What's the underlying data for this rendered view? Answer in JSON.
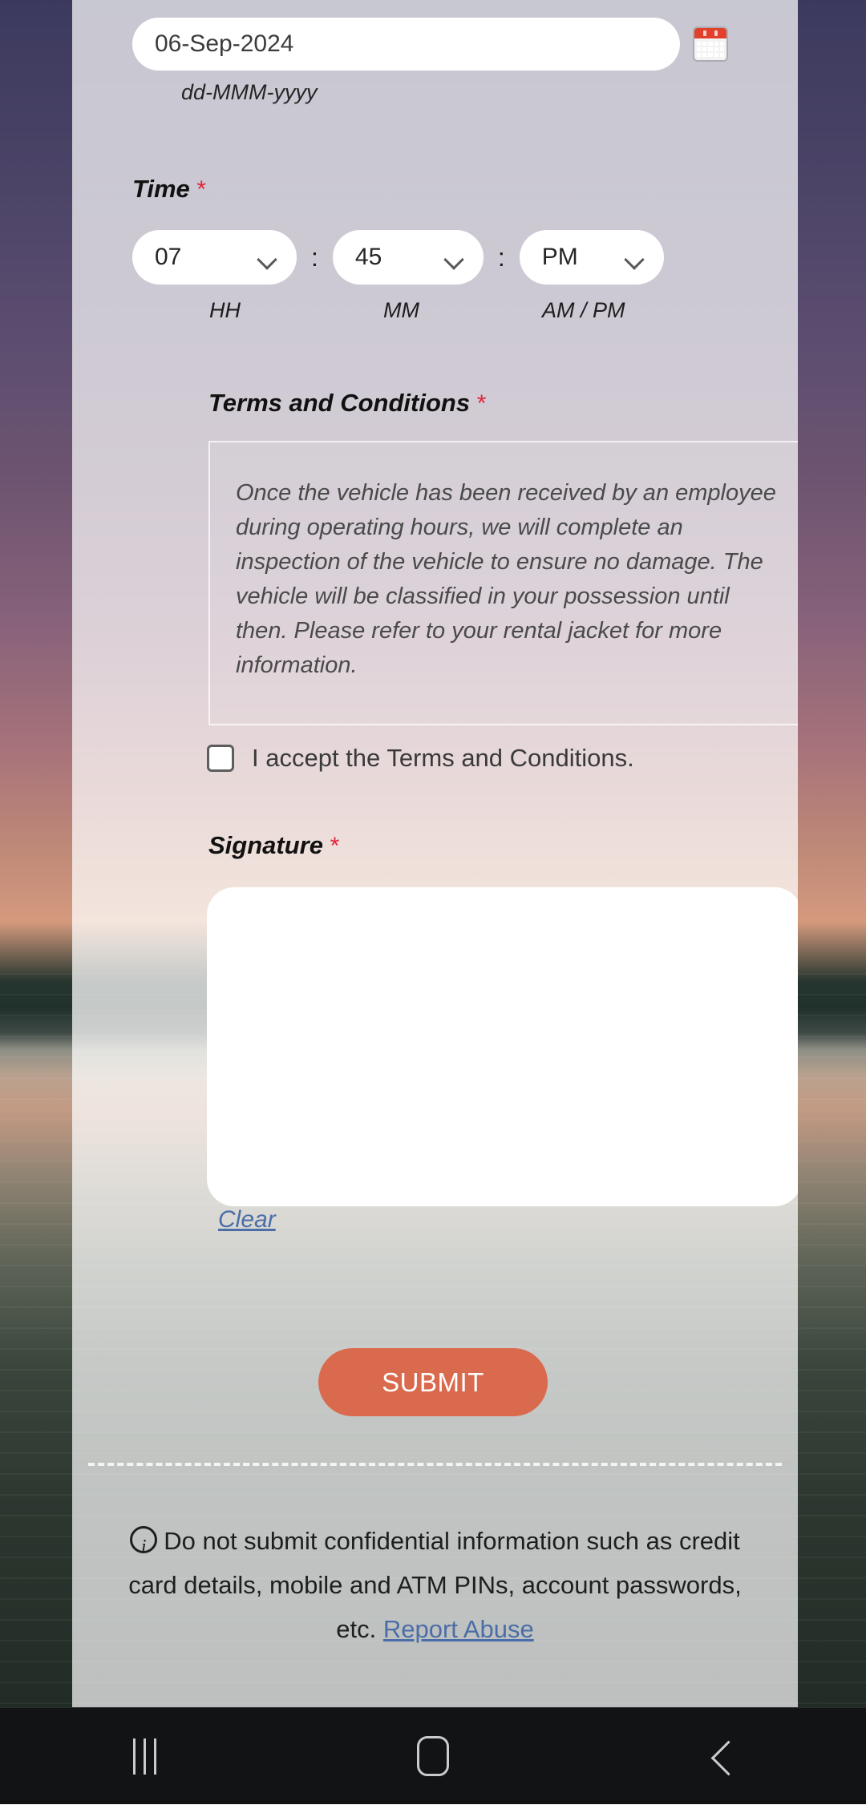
{
  "form": {
    "date": {
      "value": "06-Sep-2024",
      "placeholder": "dd-MMM-yyyy",
      "hint": "dd-MMM-yyyy",
      "calendar_icon": "calendar-icon"
    },
    "time": {
      "label": "Time",
      "required_mark": "*",
      "hour": "07",
      "minute": "45",
      "meridiem": "PM",
      "hour_hint": "HH",
      "minute_hint": "MM",
      "meridiem_hint": "AM / PM",
      "separator": ":"
    },
    "terms": {
      "label": "Terms and Conditions",
      "required_mark": "*",
      "text": "Once the vehicle has been received by an employee during operating hours, we will complete an inspection of the vehicle to ensure no damage. The vehicle will be classified in your possession until then. Please refer to your rental jacket for more information.",
      "accept_label": "I accept the Terms and Conditions.",
      "accepted": false
    },
    "signature": {
      "label": "Signature",
      "required_mark": "*",
      "value": "",
      "clear_label": "Clear"
    },
    "submit_label": "SUBMIT"
  },
  "footer": {
    "info_icon": "info-circle-icon",
    "disclaimer_part1": "Do not submit confidential information such as credit card details, mobile and ATM PINs, account passwords, etc. ",
    "report_abuse_label": "Report Abuse"
  },
  "navbar": {
    "recents_label": "recent-apps",
    "home_label": "home",
    "back_label": "back"
  },
  "colors": {
    "accent": "#da6a4e",
    "required": "#e0243c",
    "link": "#4b6ea8",
    "calendar_red": "#e0402c"
  }
}
